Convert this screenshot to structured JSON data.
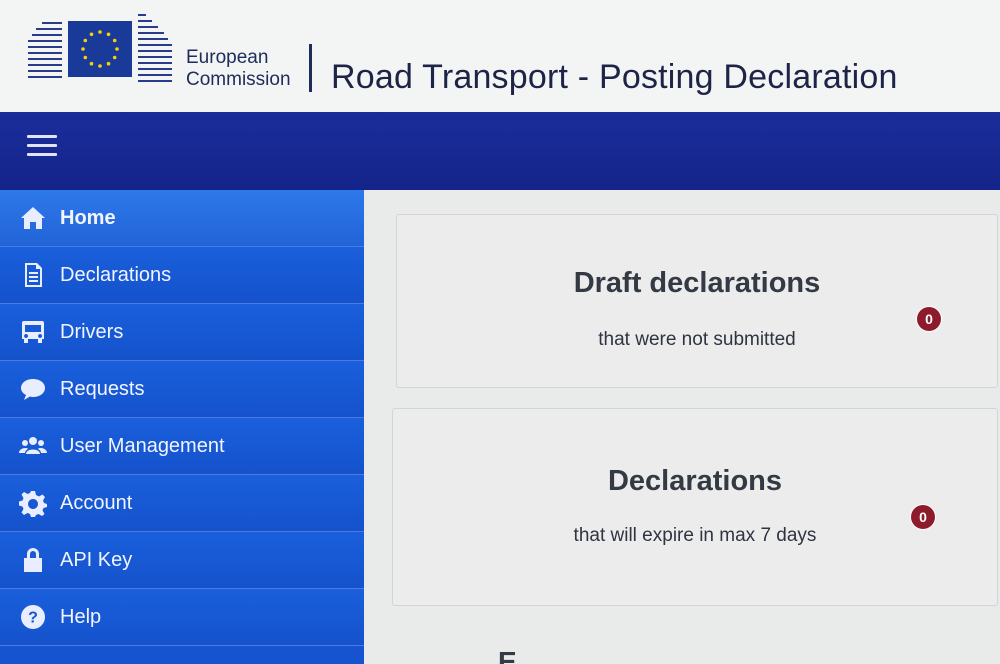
{
  "header": {
    "brand_line1": "European",
    "brand_line2": "Commission",
    "app_title": "Road Transport - Posting Declaration"
  },
  "icons": {
    "menu": "hamburger-icon",
    "home": "home-icon",
    "declarations": "document-icon",
    "drivers": "bus-icon",
    "requests": "speech-bubble-icon",
    "users": "users-icon",
    "account": "gear-icon",
    "api_key": "lock-icon",
    "help": "question-circle-icon"
  },
  "sidebar": {
    "items": [
      {
        "label": "Home"
      },
      {
        "label": "Declarations"
      },
      {
        "label": "Drivers"
      },
      {
        "label": "Requests"
      },
      {
        "label": "User Management"
      },
      {
        "label": "Account"
      },
      {
        "label": "API Key"
      },
      {
        "label": "Help"
      }
    ]
  },
  "main": {
    "cards": [
      {
        "title": "Draft declarations",
        "subtitle": "that were not submitted",
        "count": "0"
      },
      {
        "title": "Declarations",
        "subtitle": "that will expire in max 7 days",
        "count": "0"
      }
    ],
    "next_card_title_partial": "E"
  },
  "colors": {
    "navbar": "#14248a",
    "sidebar": "#1553d0",
    "sidebar_active": "#2264d8",
    "badge": "#8e1b2c",
    "header_bg": "#f3f4f4"
  }
}
